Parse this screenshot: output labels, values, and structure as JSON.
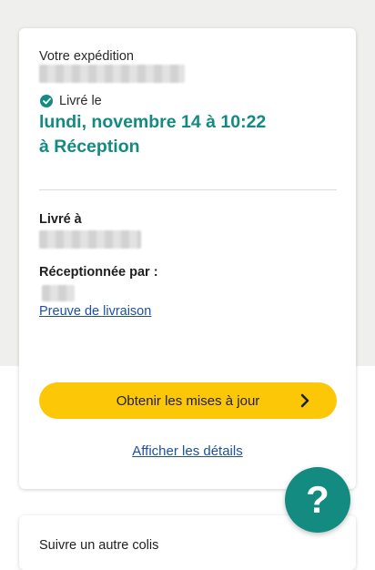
{
  "colors": {
    "accent_green": "#138b81",
    "button_yellow": "#fbc707",
    "link_blue": "#1f4fa3"
  },
  "shipment": {
    "heading": "Votre expédition",
    "status_icon": "check-circle-icon",
    "status_label": "Livré le",
    "status_date": "lundi, novembre 14 à 10:22",
    "status_location": "à Réception"
  },
  "delivery": {
    "delivered_to_label": "Livré à",
    "received_by_label": "Réceptionnée par :",
    "proof_link": "Preuve de livraison"
  },
  "actions": {
    "updates_button": "Obtenir les mises à jour",
    "updates_icon": "chevron-right-icon",
    "details_link": "Afficher les détails"
  },
  "help": {
    "label": "?",
    "icon": "help-icon"
  },
  "track_other": {
    "title": "Suivre un autre colis"
  }
}
